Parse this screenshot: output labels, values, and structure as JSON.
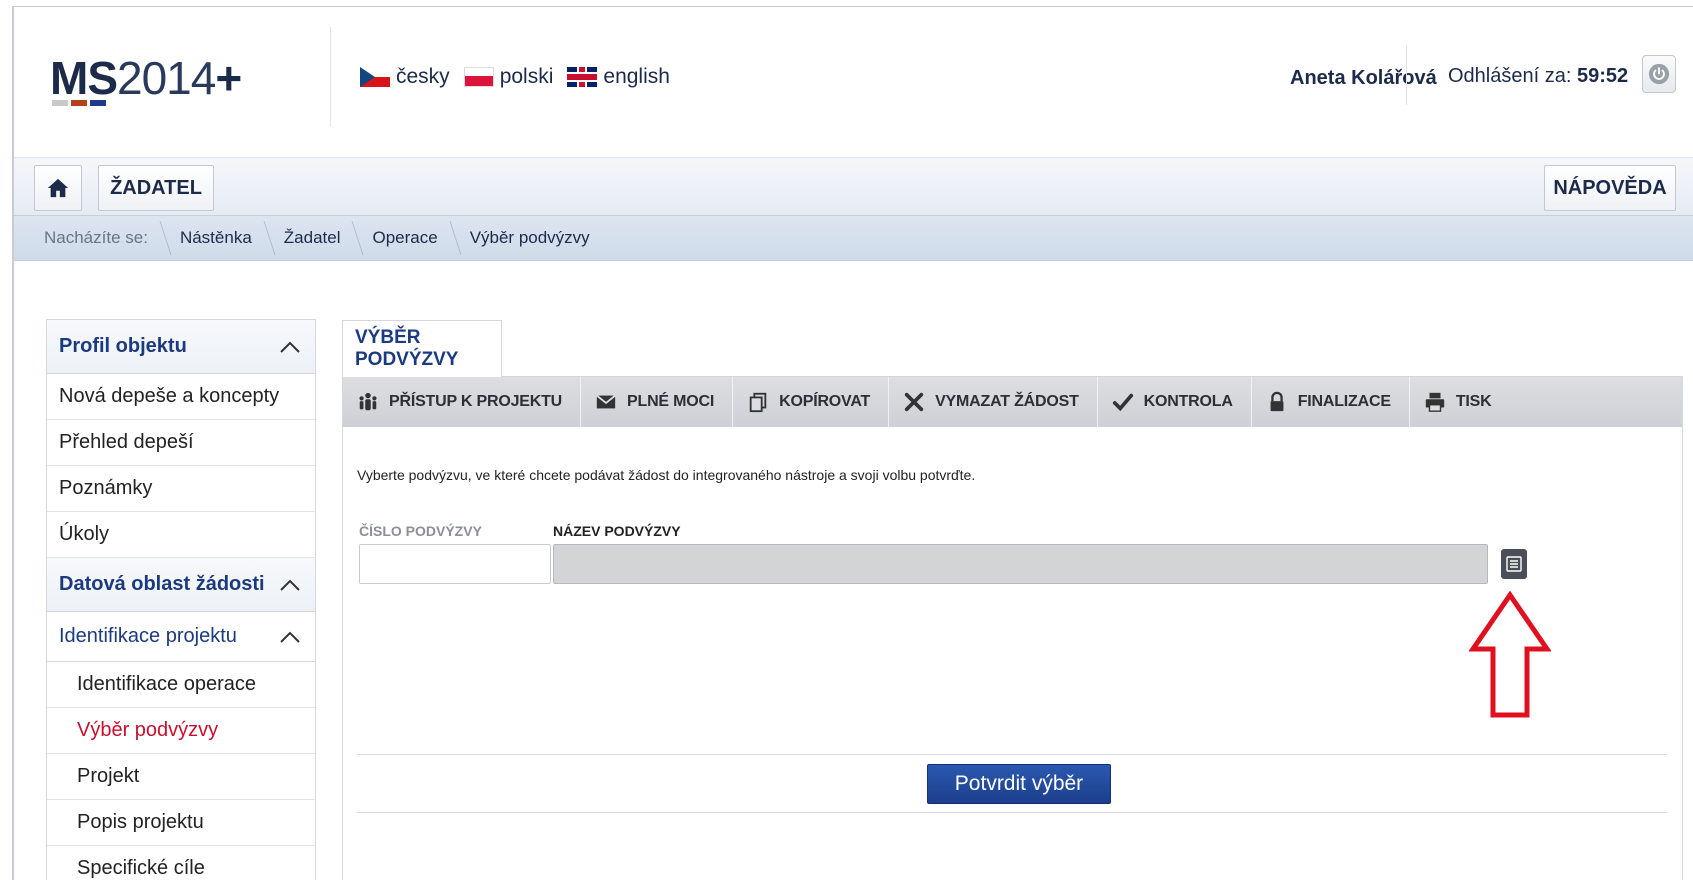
{
  "header": {
    "logo_bold": "MS",
    "logo_thin": "2014",
    "logo_plus": "+",
    "logo_bar_colors": [
      "#c9c9c9",
      "#b5401e",
      "#1f3a8c"
    ],
    "languages": [
      {
        "label": "česky",
        "flag": "flag-cz-icon"
      },
      {
        "label": "polski",
        "flag": "flag-pl-icon"
      },
      {
        "label": "english",
        "flag": "flag-uk-icon"
      }
    ],
    "user_name": "Aneta Kolářová",
    "logout_label": "Odhlášení za:",
    "logout_time": "59:52"
  },
  "navbar": {
    "home_icon": "home-icon",
    "role_label": "ŽADATEL",
    "help_label": "NÁPOVĚDA"
  },
  "breadcrumb": {
    "prefix": "Nacházíte se:",
    "items": [
      "Nástěnka",
      "Žadatel",
      "Operace",
      "Výběr podvýzvy"
    ]
  },
  "sidebar": {
    "section1": "Profil objektu",
    "section1_items": [
      "Nová depeše a koncepty",
      "Přehled depeší",
      "Poznámky",
      "Úkoly"
    ],
    "section2": "Datová oblast žádosti",
    "subsection": "Identifikace projektu",
    "sub_items": [
      "Identifikace operace",
      "Výběr podvýzvy",
      "Projekt",
      "Popis projektu",
      "Specifické cíle"
    ],
    "active_item": "Výběr podvýzvy"
  },
  "content": {
    "tab_label": "VÝBĚR PODVÝZVY",
    "toolbar": [
      {
        "label": "PŘÍSTUP K PROJEKTU",
        "icon": "people-icon"
      },
      {
        "label": "PLNÉ MOCI",
        "icon": "envelope-icon"
      },
      {
        "label": "KOPÍROVAT",
        "icon": "copy-icon"
      },
      {
        "label": "VYMAZAT ŽÁDOST",
        "icon": "delete-x-icon"
      },
      {
        "label": "KONTROLA",
        "icon": "check-icon"
      },
      {
        "label": "FINALIZACE",
        "icon": "lock-icon"
      },
      {
        "label": "TISK",
        "icon": "print-icon"
      }
    ],
    "instruction": "Vyberte podvýzvu, ve které chcete podávat žádost do integrovaného nástroje a svoji volbu potvrďte.",
    "field_number_label": "ČÍSLO PODVÝZVY",
    "field_number_value": "",
    "field_name_label": "NÁZEV PODVÝZVY",
    "field_name_value": "",
    "list_button_icon": "list-icon",
    "confirm_label": "Potvrdit výběr",
    "arrow_color": "#e0101f"
  }
}
